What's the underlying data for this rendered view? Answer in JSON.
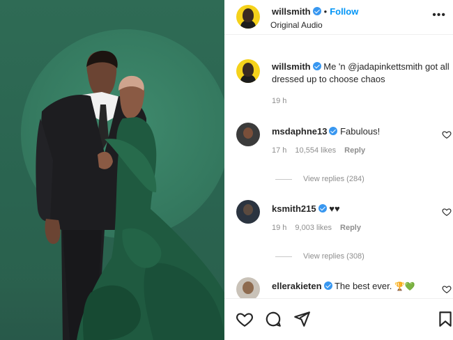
{
  "post": {
    "author": {
      "username": "willsmith",
      "follow_label": "Follow",
      "separator": "•",
      "audio": "Original Audio"
    },
    "caption": {
      "username": "willsmith",
      "text": "Me 'n @jadapinkettsmith got all dressed up to choose chaos",
      "time": "19 h"
    }
  },
  "comments": [
    {
      "username": "msdaphne13",
      "text": "Fabulous!",
      "time": "17 h",
      "likes": "10,554 likes",
      "reply_label": "Reply",
      "view_replies": "View replies (284)",
      "avatar_icon": "user-avatar"
    },
    {
      "username": "ksmith215",
      "text": "♥♥",
      "time": "19 h",
      "likes": "9,003 likes",
      "reply_label": "Reply",
      "view_replies": "View replies (308)",
      "avatar_icon": "user-avatar"
    },
    {
      "username": "ellerakieten",
      "text": "The best ever.",
      "emoji": "🏆💚",
      "avatar_icon": "user-avatar"
    }
  ],
  "icons": {
    "more": "more-icon",
    "like": "heart-icon",
    "comment": "comment-icon",
    "share": "send-icon",
    "save": "bookmark-icon"
  },
  "colors": {
    "follow_blue": "#0095f6",
    "verified_blue": "#3897f0",
    "secondary_text": "#8e8e8e",
    "backdrop_green": "#2f6b55",
    "gown_green": "#1f5a40"
  }
}
